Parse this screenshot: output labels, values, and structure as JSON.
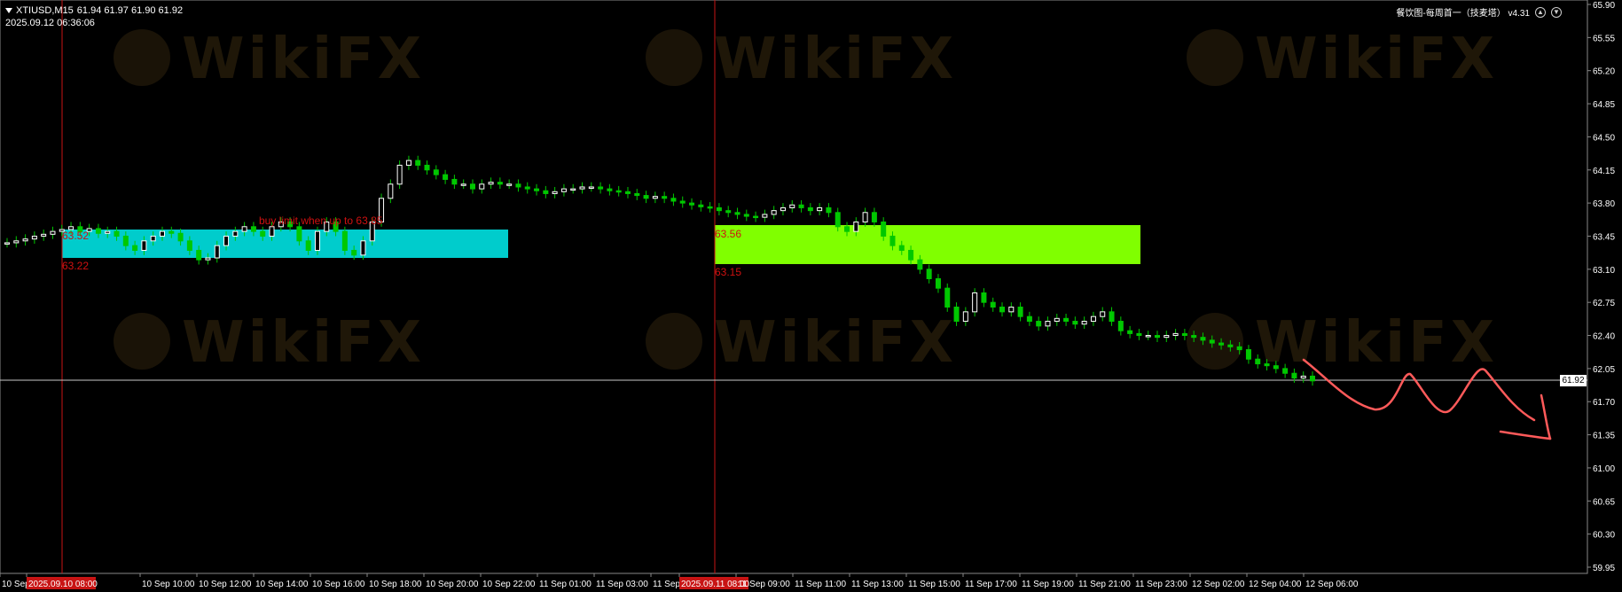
{
  "header": {
    "symbol": "XTIUSD,M15",
    "ohlc": "61.94 61.97 61.90 61.92",
    "timestamp": "2025.09.12 06:36:06"
  },
  "indicator": {
    "label": "餐饮图-每周首一（技麦塔） v4.31"
  },
  "watermark": "WikiFX",
  "current_price": "61.92",
  "price_axis": [
    "65.90",
    "65.55",
    "65.20",
    "64.85",
    "64.50",
    "64.15",
    "63.80",
    "63.45",
    "63.10",
    "62.75",
    "62.40",
    "62.05",
    "61.70",
    "61.35",
    "61.00",
    "60.65",
    "60.30",
    "59.95"
  ],
  "time_axis": [
    "10 Sep",
    "2025.09.10 08:00",
    "10 Sep 10:00",
    "10 Sep 12:00",
    "10 Sep 14:00",
    "10 Sep 16:00",
    "10 Sep 18:00",
    "10 Sep 20:00",
    "10 Sep 22:00",
    "11 Sep 01:00",
    "11 Sep 03:00",
    "11 Sep 05:00",
    "2025.09.11 08:00",
    "11 Sep 09:00",
    "11 Sep 11:00",
    "11 Sep 13:00",
    "11 Sep 15:00",
    "11 Sep 17:00",
    "11 Sep 19:00",
    "11 Sep 21:00",
    "11 Sep 23:00",
    "12 Sep 02:00",
    "12 Sep 04:00",
    "12 Sep 06:00"
  ],
  "zones": [
    {
      "name": "cyan-zone",
      "top_label": "63.52",
      "bottom_label": "63.22",
      "note": "buy limit when up to 63.85",
      "color": "#00cccc"
    },
    {
      "name": "green-zone",
      "top_label": "63.56",
      "bottom_label": "63.15",
      "color": "#80ff00"
    }
  ],
  "colors": {
    "bull_candle": "#ffffff",
    "bear_candle": "#00c800",
    "zone_text": "#d01010",
    "vline": "#c81414",
    "hand_drawn": "#ff5a5a"
  },
  "chart_data": {
    "type": "candlestick",
    "ylim": [
      59.95,
      65.9
    ],
    "current_price": 61.92,
    "series": [
      {
        "values": [
          63.38,
          63.4,
          63.42,
          63.45,
          63.47,
          63.5,
          63.52,
          63.55,
          63.5,
          63.53,
          63.48,
          63.5,
          63.45,
          63.35,
          63.3,
          63.4,
          63.45,
          63.5,
          63.48,
          63.4,
          63.3,
          63.2,
          63.22,
          63.35,
          63.45,
          63.5,
          63.55,
          63.5,
          63.45,
          63.55,
          63.6,
          63.55,
          63.4,
          63.3,
          63.5,
          63.6,
          63.5,
          63.3,
          63.25,
          63.4,
          63.6,
          63.85,
          64.0,
          64.2,
          64.25,
          64.2,
          64.15,
          64.1,
          64.05,
          64.0,
          64.0,
          63.95,
          64.0,
          64.02,
          64.0,
          64.0,
          63.97,
          63.95,
          63.93,
          63.9,
          63.92,
          63.95,
          63.95,
          63.97,
          63.97,
          63.95,
          63.93,
          63.92,
          63.9,
          63.88,
          63.85,
          63.87,
          63.85,
          63.82,
          63.8,
          63.78,
          63.76,
          63.75,
          63.72,
          63.7,
          63.68,
          63.66,
          63.65,
          63.68,
          63.72,
          63.75,
          63.78,
          63.75,
          63.72,
          63.75,
          63.7,
          63.55,
          63.5,
          63.6,
          63.7,
          63.6,
          63.45,
          63.35,
          63.3,
          63.2,
          63.1,
          63.0,
          62.9,
          62.7,
          62.55,
          62.65,
          62.85,
          62.75,
          62.7,
          62.65,
          62.7,
          62.6,
          62.55,
          62.5,
          62.55,
          62.58,
          62.55,
          62.52,
          62.55,
          62.6,
          62.65,
          62.55,
          62.45,
          62.42,
          62.4,
          62.4,
          62.38,
          62.4,
          62.42,
          62.4,
          62.38,
          62.35,
          62.32,
          62.3,
          62.28,
          62.25,
          62.15,
          62.1,
          62.08,
          62.05,
          62.0,
          61.95,
          61.97,
          61.92
        ]
      }
    ]
  }
}
